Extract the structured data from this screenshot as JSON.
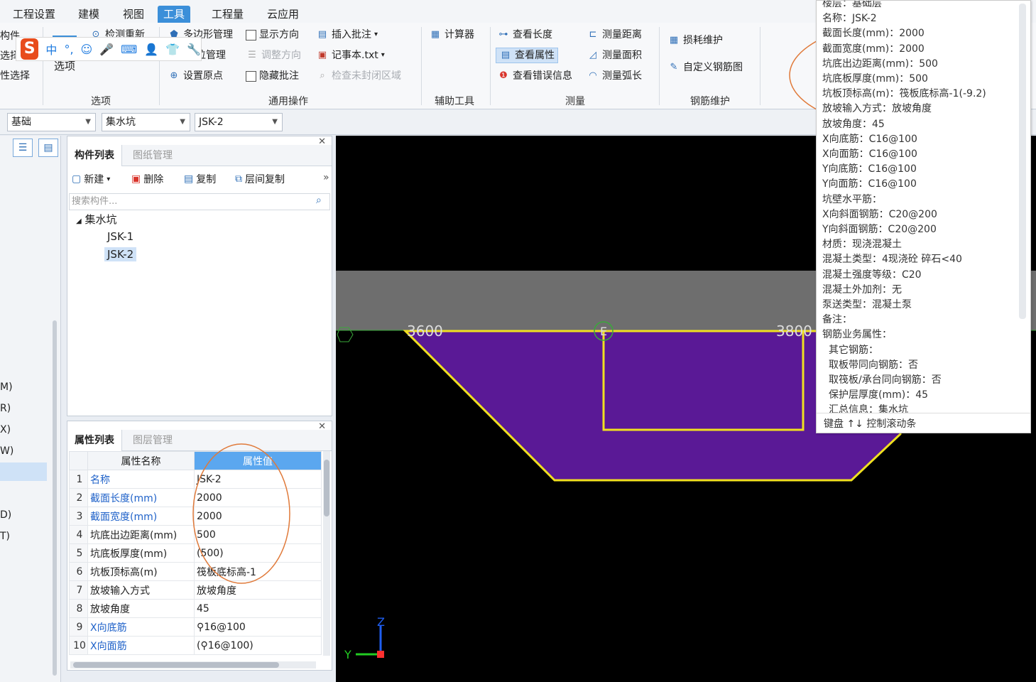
{
  "menu": {
    "tabs": [
      "工程设置",
      "建模",
      "视图",
      "工具",
      "工程量",
      "云应用"
    ],
    "active": "工具"
  },
  "ribbon": {
    "left_partial": [
      "构件",
      "选择",
      "性选择"
    ],
    "select_group": {
      "items": [
        "检测重新",
        "形管理",
        "选项"
      ],
      "label": "选项"
    },
    "general_ops": {
      "polygon_manage": "多边形管理",
      "align_manage": "位管理",
      "set_origin": "设置原点",
      "show_direction": "显示方向",
      "adjust_direction": "调整方向",
      "hide_annotation": "隐藏批注",
      "insert_annotation": "插入批注",
      "notepad": "记事本.txt",
      "check_unclosed": "检查未封闭区域",
      "label": "通用操作"
    },
    "aux_tools": {
      "calculator": "计算器",
      "label": "辅助工具"
    },
    "measure": {
      "view_length": "查看长度",
      "view_properties": "查看属性",
      "view_errors": "查看错误信息",
      "measure_distance": "测量距离",
      "measure_area": "测量面积",
      "measure_arc": "测量弧长",
      "label": "测量"
    },
    "rebar_maint": {
      "loss_maint": "损耗维护",
      "custom_rebar": "自定义钢筋图",
      "label": "钢筋维护"
    }
  },
  "ime": {
    "logo": "S",
    "items": [
      "中",
      "°,",
      "☺",
      "🎤",
      "⌨",
      "👤",
      "👕",
      "🔧"
    ]
  },
  "dropdowns": {
    "floor": "基础",
    "type": "集水坑",
    "component": "JSK-2"
  },
  "left_panel": {
    "keys": [
      "M)",
      "R)",
      "X)",
      "W)",
      "D)",
      "T)"
    ]
  },
  "component_list": {
    "tabs": [
      "构件列表",
      "图纸管理"
    ],
    "toolbar": {
      "new": "新建",
      "delete": "删除",
      "copy": "复制",
      "floor_copy": "层间复制"
    },
    "search_placeholder": "搜索构件...",
    "tree": {
      "root": "集水坑",
      "children": [
        "JSK-1",
        "JSK-2"
      ],
      "selected": "JSK-2"
    }
  },
  "property_list": {
    "tabs": [
      "属性列表",
      "图层管理"
    ],
    "headers": {
      "name": "属性名称",
      "value": "属性值"
    },
    "rows": [
      {
        "num": "1",
        "name": "名称",
        "value": "JSK-2",
        "link": true
      },
      {
        "num": "2",
        "name": "截面长度(mm)",
        "value": "2000",
        "link": true
      },
      {
        "num": "3",
        "name": "截面宽度(mm)",
        "value": "2000",
        "link": true
      },
      {
        "num": "4",
        "name": "坑底出边距离(mm)",
        "value": "500",
        "link": false
      },
      {
        "num": "5",
        "name": "坑底板厚度(mm)",
        "value": "(500)",
        "link": false
      },
      {
        "num": "6",
        "name": "坑板顶标高(m)",
        "value": "筏板底标高-1",
        "link": false
      },
      {
        "num": "7",
        "name": "放坡输入方式",
        "value": "放坡角度",
        "link": false
      },
      {
        "num": "8",
        "name": "放坡角度",
        "value": "45",
        "link": false
      },
      {
        "num": "9",
        "name": "X向底筋",
        "value": "⚲16@100",
        "link": true
      },
      {
        "num": "10",
        "name": "X向面筋",
        "value": "(⚲16@100)",
        "link": true
      }
    ]
  },
  "canvas": {
    "dims": [
      "3600",
      "3800"
    ],
    "axis_label": "E",
    "axis_y": "Y",
    "axis_z": "Z",
    "colors": {
      "pit_fill": "#5a1996",
      "outline": "#f0e020",
      "band": "#6e6e6e",
      "axis_z": "#1f5ef0",
      "axis_y": "#22cc22"
    }
  },
  "tooltip": {
    "lines": [
      {
        "text": "楼层：基础层",
        "indent": 0
      },
      {
        "text": "名称：JSK-2",
        "indent": 0
      },
      {
        "text": "截面长度(mm)：2000",
        "indent": 0
      },
      {
        "text": "截面宽度(mm)：2000",
        "indent": 0
      },
      {
        "text": "坑底出边距离(mm)：500",
        "indent": 0
      },
      {
        "text": "坑底板厚度(mm)：500",
        "indent": 0
      },
      {
        "text": "坑板顶标高(m)：筏板底标高-1(-9.2)",
        "indent": 0
      },
      {
        "text": "放坡输入方式：放坡角度",
        "indent": 0
      },
      {
        "text": "放坡角度：45",
        "indent": 0
      },
      {
        "text": "X向底筋：C16@100",
        "indent": 0
      },
      {
        "text": "X向面筋：C16@100",
        "indent": 0
      },
      {
        "text": "Y向底筋：C16@100",
        "indent": 0
      },
      {
        "text": "Y向面筋：C16@100",
        "indent": 0
      },
      {
        "text": "坑壁水平筋：",
        "indent": 0
      },
      {
        "text": "X向斜面钢筋：C20@200",
        "indent": 0
      },
      {
        "text": "Y向斜面钢筋：C20@200",
        "indent": 0
      },
      {
        "text": "材质：现浇混凝土",
        "indent": 0
      },
      {
        "text": "混凝土类型：4现浇砼 碎石<40",
        "indent": 0
      },
      {
        "text": "混凝土强度等级：C20",
        "indent": 0
      },
      {
        "text": "混凝土外加剂：无",
        "indent": 0
      },
      {
        "text": "泵送类型：混凝土泵",
        "indent": 0
      },
      {
        "text": "备注：",
        "indent": 0
      },
      {
        "text": "钢筋业务属性：",
        "indent": 0
      },
      {
        "text": "其它钢筋：",
        "indent": 1
      },
      {
        "text": "取板带同向钢筋：否",
        "indent": 2
      },
      {
        "text": "取筏板/承台同向钢筋：否",
        "indent": 2
      },
      {
        "text": "保护层厚度(mm)：45",
        "indent": 2
      },
      {
        "text": "汇总信息：集水坑",
        "indent": 2
      }
    ],
    "footer": "键盘 ↑↓ 控制滚动条"
  },
  "annotation_color": "#e07a3a"
}
